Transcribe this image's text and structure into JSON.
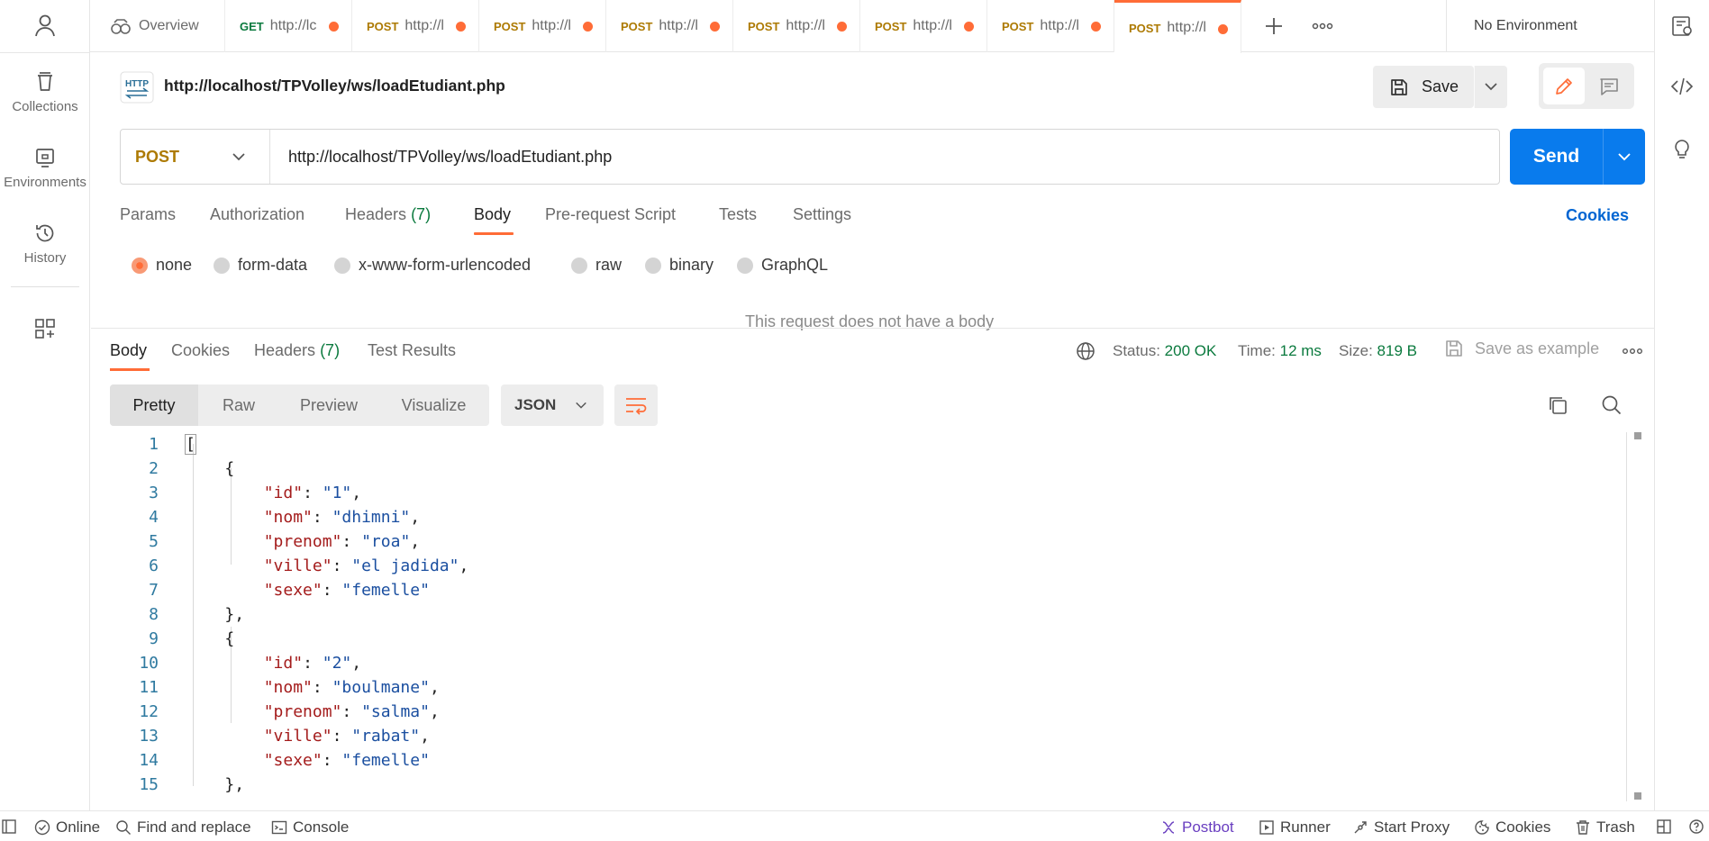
{
  "sidebar": {
    "items": [
      {
        "label": "Collections",
        "icon": "collections-icon"
      },
      {
        "label": "Environments",
        "icon": "environments-icon"
      },
      {
        "label": "History",
        "icon": "history-icon"
      }
    ]
  },
  "tabs": {
    "overview": "Overview",
    "items": [
      {
        "method": "GET",
        "url": "http://lc"
      },
      {
        "method": "POST",
        "url": "http://l"
      },
      {
        "method": "POST",
        "url": "http://l"
      },
      {
        "method": "POST",
        "url": "http://l"
      },
      {
        "method": "POST",
        "url": "http://l"
      },
      {
        "method": "POST",
        "url": "http://l"
      },
      {
        "method": "POST",
        "url": "http://l"
      },
      {
        "method": "POST",
        "url": "http://l"
      }
    ],
    "environment": "No Environment",
    "unsaved_color": "#ff6c37"
  },
  "request": {
    "title": "http://localhost/TPVolley/ws/loadEtudiant.php",
    "save_label": "Save",
    "method": "POST",
    "url": "http://localhost/TPVolley/ws/loadEtudiant.php",
    "send_label": "Send",
    "tabs": {
      "params": "Params",
      "authorization": "Authorization",
      "headers": "Headers",
      "headers_count": "(7)",
      "body": "Body",
      "prerequest": "Pre-request Script",
      "tests": "Tests",
      "settings": "Settings"
    },
    "cookies_label": "Cookies",
    "body_types": [
      "none",
      "form-data",
      "x-www-form-urlencoded",
      "raw",
      "binary",
      "GraphQL"
    ],
    "selected_body_type": "none",
    "no_body_message": "This request does not have a body"
  },
  "response": {
    "tabs": {
      "body": "Body",
      "cookies": "Cookies",
      "headers": "Headers",
      "headers_count": "(7)",
      "tests": "Test Results"
    },
    "status_label": "Status:",
    "status_value": "200 OK",
    "time_label": "Time:",
    "time_value": "12 ms",
    "size_label": "Size:",
    "size_value": "819 B",
    "save_example": "Save as example",
    "formats": [
      "Pretty",
      "Raw",
      "Preview",
      "Visualize"
    ],
    "selected_format": "Pretty",
    "language": "JSON",
    "lines": [
      {
        "n": "1",
        "t": "["
      },
      {
        "n": "2",
        "t": "{"
      },
      {
        "n": "3",
        "k": "\"id\"",
        "v": "\"1\""
      },
      {
        "n": "4",
        "k": "\"nom\"",
        "v": "\"dhimni\""
      },
      {
        "n": "5",
        "k": "\"prenom\"",
        "v": "\"roa\""
      },
      {
        "n": "6",
        "k": "\"ville\"",
        "v": "\"el jadida\""
      },
      {
        "n": "7",
        "k": "\"sexe\"",
        "v": "\"femelle\""
      },
      {
        "n": "8",
        "t": "},"
      },
      {
        "n": "9",
        "t": "{"
      },
      {
        "n": "10",
        "k": "\"id\"",
        "v": "\"2\""
      },
      {
        "n": "11",
        "k": "\"nom\"",
        "v": "\"boulmane\""
      },
      {
        "n": "12",
        "k": "\"prenom\"",
        "v": "\"salma\""
      },
      {
        "n": "13",
        "k": "\"ville\"",
        "v": "\"rabat\""
      },
      {
        "n": "14",
        "k": "\"sexe\"",
        "v": "\"femelle\""
      },
      {
        "n": "15",
        "t": "},"
      }
    ]
  },
  "statusbar": {
    "online": "Online",
    "find_replace": "Find and replace",
    "console": "Console",
    "postbot": "Postbot",
    "runner": "Runner",
    "start_proxy": "Start Proxy",
    "cookies": "Cookies",
    "trash": "Trash"
  },
  "colors": {
    "accent": "#ff6c37",
    "send": "#097bed",
    "post_method": "#ad7a03",
    "get_method": "#0b7a3e",
    "status_ok": "#0b7a3e",
    "json_key": "#a41c1c",
    "json_string": "#1b4fa0"
  }
}
